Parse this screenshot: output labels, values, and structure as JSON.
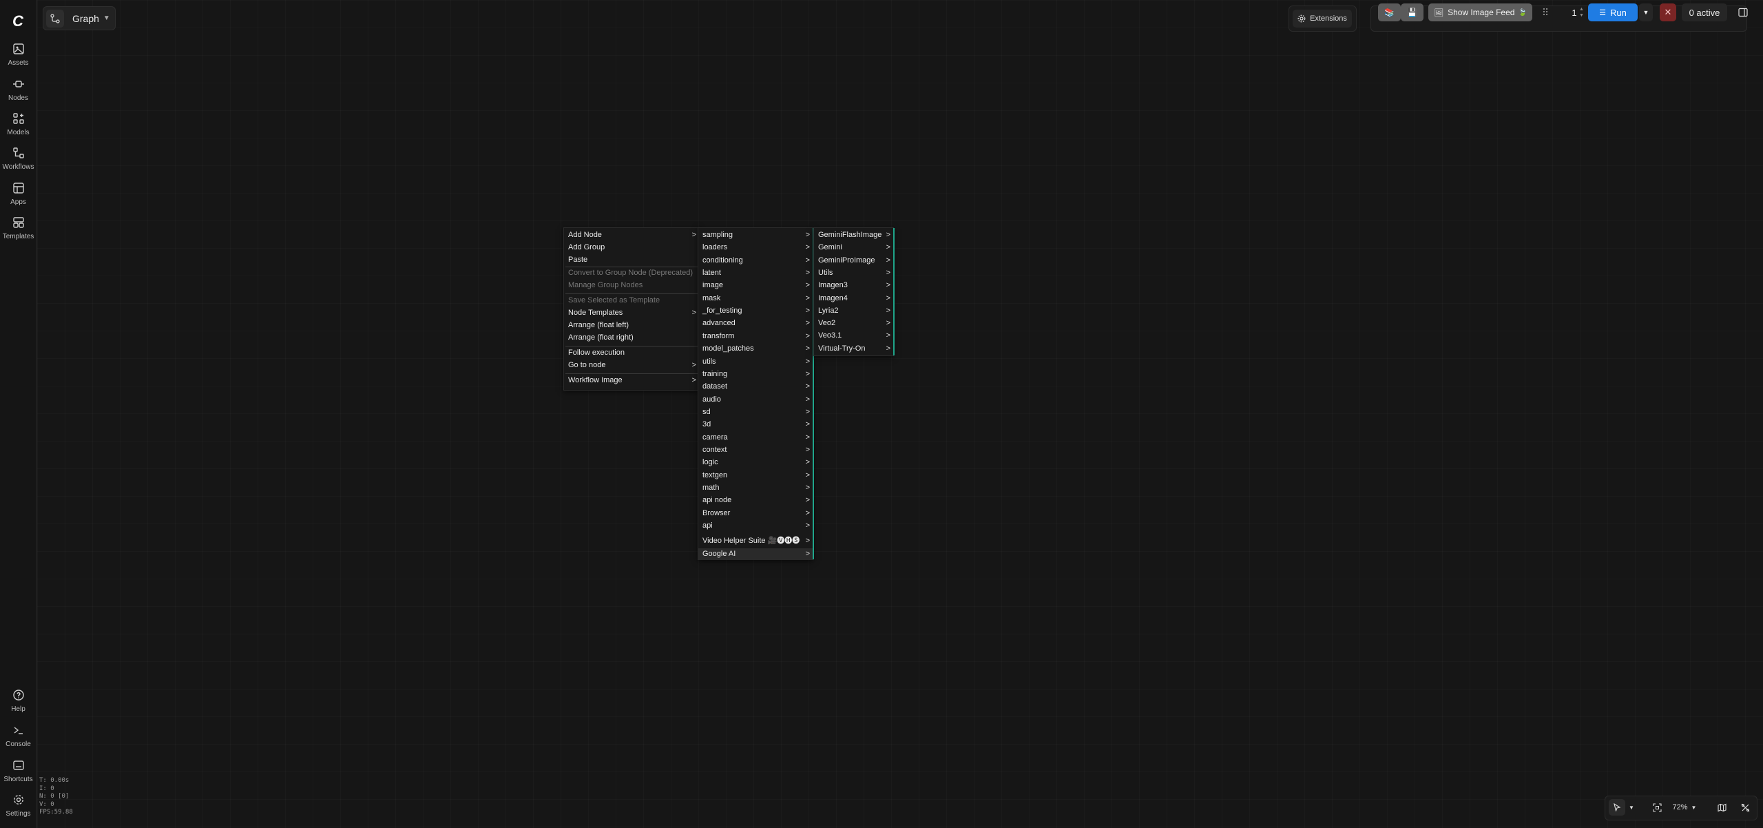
{
  "header": {
    "graph_title": "Graph",
    "extensions_label": "Extensions",
    "show_image_feed_label": "Show Image Feed",
    "queue_count": "1",
    "run_label": "Run",
    "active_label": "0 active"
  },
  "sidebar": {
    "items": [
      {
        "label": "Assets",
        "icon": "image-icon"
      },
      {
        "label": "Nodes",
        "icon": "nodes-icon"
      },
      {
        "label": "Models",
        "icon": "models-icon"
      },
      {
        "label": "Workflows",
        "icon": "workflow-icon"
      },
      {
        "label": "Apps",
        "icon": "apps-icon"
      },
      {
        "label": "Templates",
        "icon": "templates-icon"
      }
    ],
    "bottom_items": [
      {
        "label": "Help",
        "icon": "help-icon"
      },
      {
        "label": "Console",
        "icon": "terminal-icon"
      },
      {
        "label": "Shortcuts",
        "icon": "keyboard-icon"
      },
      {
        "label": "Settings",
        "icon": "gear-icon"
      }
    ]
  },
  "stats": {
    "t": "T: 0.00s",
    "i": "I: 0",
    "n": "N: 0 [0]",
    "v": "V: 0",
    "fps": "FPS:59.88"
  },
  "context_menu": {
    "items": [
      {
        "label": "Add Node",
        "submenu": true,
        "disabled": false
      },
      {
        "label": "Add Group",
        "submenu": false,
        "disabled": false
      },
      {
        "label": "Paste",
        "submenu": false,
        "disabled": false
      },
      {
        "label": "Convert to Group Node (Deprecated)",
        "submenu": false,
        "disabled": true
      },
      {
        "label": "Manage Group Nodes",
        "submenu": false,
        "disabled": true
      },
      {
        "label": "Save Selected as Template",
        "submenu": false,
        "disabled": true
      },
      {
        "label": "Node Templates",
        "submenu": true,
        "disabled": false
      },
      {
        "label": "Arrange (float left)",
        "submenu": false,
        "disabled": false
      },
      {
        "label": "Arrange (float right)",
        "submenu": false,
        "disabled": false
      },
      {
        "label": "Follow execution",
        "submenu": false,
        "disabled": false
      },
      {
        "label": "Go to node",
        "submenu": true,
        "disabled": false
      },
      {
        "label": "Workflow Image",
        "submenu": true,
        "disabled": false
      }
    ]
  },
  "category_menu": {
    "items": [
      "sampling",
      "loaders",
      "conditioning",
      "latent",
      "image",
      "mask",
      "_for_testing",
      "advanced",
      "transform",
      "model_patches",
      "utils",
      "training",
      "dataset",
      "audio",
      "sd",
      "3d",
      "camera",
      "context",
      "logic",
      "textgen",
      "math",
      "api node",
      "Browser",
      "api",
      "Video Helper Suite 🎥🅥🅗🅢",
      "Google AI"
    ],
    "highlighted": "Google AI"
  },
  "google_ai_menu": {
    "items": [
      "GeminiFlashImage",
      "Gemini",
      "GeminiProImage",
      "Utils",
      "Imagen3",
      "Imagen4",
      "Lyria2",
      "Veo2",
      "Veo3.1",
      "Virtual-Try-On"
    ]
  },
  "submenu_arrow": ">",
  "canvas_controls": {
    "zoom": "72%"
  },
  "colors": {
    "accent": "#1f7ce3",
    "menu_edge": "#1fa58a",
    "background": "#161616"
  }
}
